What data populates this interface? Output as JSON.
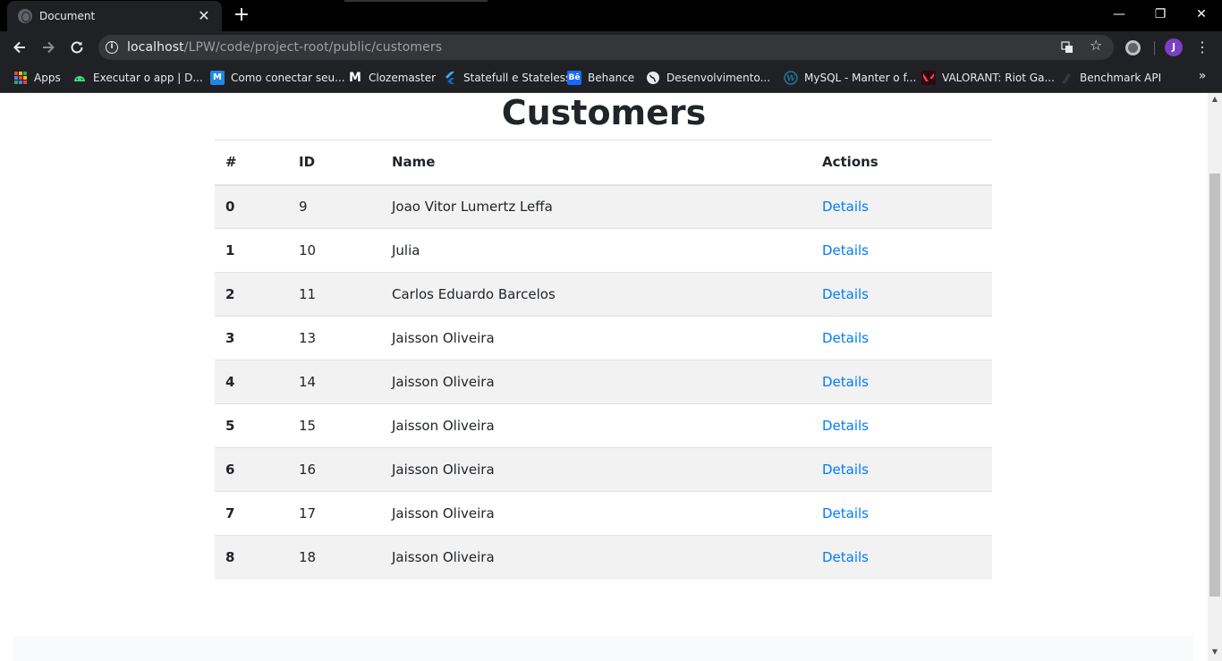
{
  "browser": {
    "tab_title": "Document",
    "tab_close": "✕",
    "new_tab": "+",
    "minimize": "—",
    "restore": "❐",
    "close": "✕",
    "url_host": "localhost",
    "url_path": "/LPW/code/project-root/public/customers",
    "avatar_letter": "J",
    "bookmarks": [
      {
        "label": "Apps",
        "icon": "apps-grid-icon"
      },
      {
        "label": "Executar o app  |  D...",
        "icon": "android-icon"
      },
      {
        "label": "Como conectar seu...",
        "icon": "m-logo-icon"
      },
      {
        "label": "Clozemaster",
        "icon": "clozemaster-icon"
      },
      {
        "label": "Statefull e Stateless",
        "icon": "flutter-icon"
      },
      {
        "label": "Behance",
        "icon": "behance-icon"
      },
      {
        "label": "Desenvolvimento...",
        "icon": "globe-icon"
      },
      {
        "label": "MySQL - Manter o f...",
        "icon": "wordpress-icon"
      },
      {
        "label": "VALORANT: Riot Ga...",
        "icon": "valorant-icon"
      },
      {
        "label": "Benchmark API",
        "icon": "benchmark-icon"
      }
    ]
  },
  "page": {
    "title": "Customers",
    "table": {
      "headers": [
        "#",
        "ID",
        "Name",
        "Actions"
      ],
      "rows": [
        {
          "index": "0",
          "id": "9",
          "name": "Joao Vitor Lumertz Leffa",
          "action": "Details"
        },
        {
          "index": "1",
          "id": "10",
          "name": "Julia",
          "action": "Details"
        },
        {
          "index": "2",
          "id": "11",
          "name": "Carlos Eduardo Barcelos",
          "action": "Details"
        },
        {
          "index": "3",
          "id": "13",
          "name": "Jaisson Oliveira",
          "action": "Details"
        },
        {
          "index": "4",
          "id": "14",
          "name": "Jaisson Oliveira",
          "action": "Details"
        },
        {
          "index": "5",
          "id": "15",
          "name": "Jaisson Oliveira",
          "action": "Details"
        },
        {
          "index": "6",
          "id": "16",
          "name": "Jaisson Oliveira",
          "action": "Details"
        },
        {
          "index": "7",
          "id": "17",
          "name": "Jaisson Oliveira",
          "action": "Details"
        },
        {
          "index": "8",
          "id": "18",
          "name": "Jaisson Oliveira",
          "action": "Details"
        }
      ]
    }
  },
  "colors": {
    "link": "#007bff",
    "stripe": "#f2f2f2",
    "text": "#212529"
  }
}
